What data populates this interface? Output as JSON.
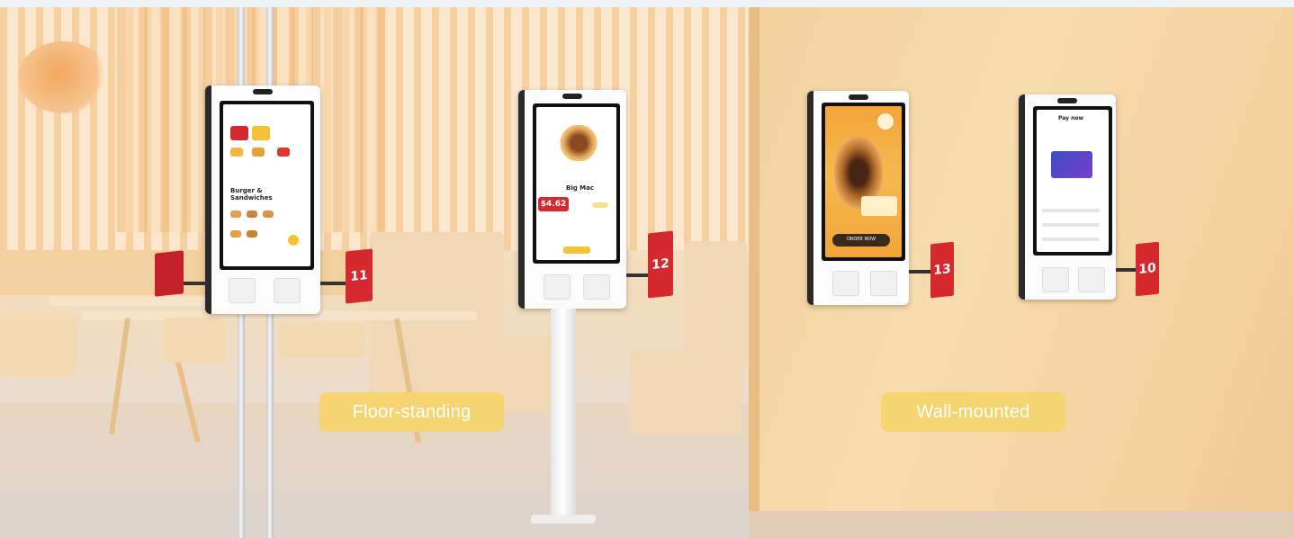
{
  "labels": {
    "floor_standing": "Floor-standing",
    "wall_mounted": "Wall-mounted"
  },
  "kiosks": [
    {
      "tag": "11",
      "screen_title": "Burger & Sandwiches"
    },
    {
      "tag": "12",
      "screen_title": "Big Mac",
      "price": "$4.62"
    },
    {
      "tag": "13",
      "screen_title": "ORDER NOW"
    },
    {
      "tag": "10",
      "screen_title": "Pay now"
    }
  ],
  "colors": {
    "label_pill": "#f7d472",
    "tag_red": "#d42a2f",
    "wall": "#f4d4a2"
  }
}
